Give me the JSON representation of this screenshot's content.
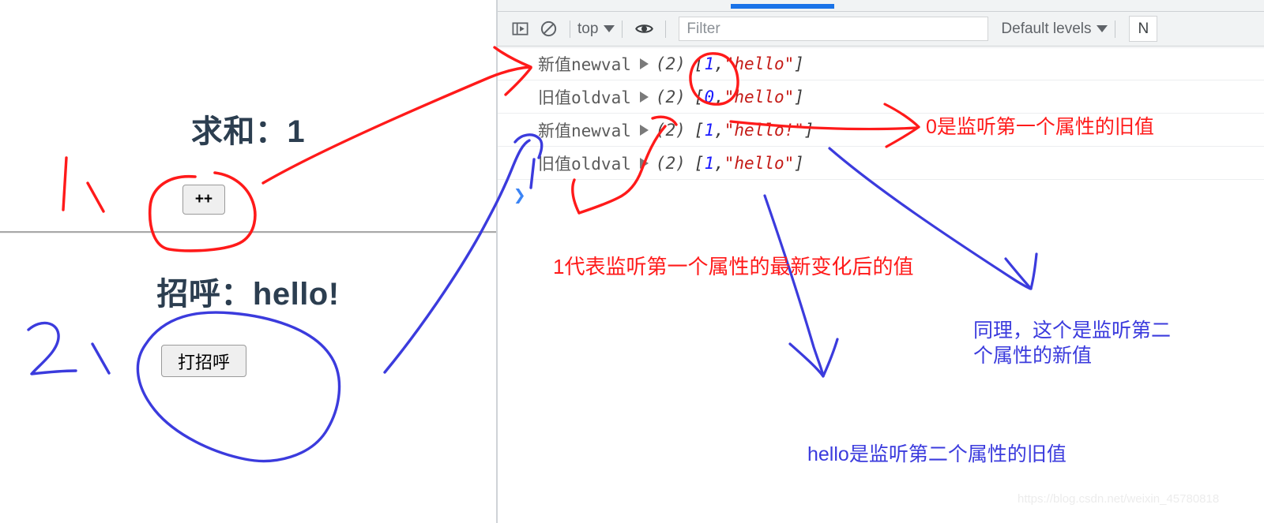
{
  "page": {
    "sum_heading": "求和：1",
    "greet_heading": "招呼：hello!",
    "increment_button": "++",
    "greet_button": "打招呼"
  },
  "devtools": {
    "toolbar": {
      "sidebar_icon": "console-sidebar-icon",
      "clear_icon": "clear-console-icon",
      "context_label": "top",
      "eye_icon": "live-expression-eye-icon",
      "filter_placeholder": "Filter",
      "filter_value": "",
      "levels_label": "Default levels",
      "issues_label": "N"
    },
    "console_rows": [
      {
        "label": "新值newval",
        "disclosure": "expand-triangle-icon",
        "count": "(2)",
        "open": "[",
        "num": "1",
        "comma": ", ",
        "str": "\"hello\"",
        "close": "]"
      },
      {
        "label": "旧值oldval",
        "disclosure": "expand-triangle-icon",
        "count": "(2)",
        "open": "[",
        "num": "0",
        "comma": ", ",
        "str": "\"hello\"",
        "close": "]"
      },
      {
        "label": "新值newval",
        "disclosure": "expand-triangle-icon",
        "count": "(2)",
        "open": "[",
        "num": "1",
        "comma": ", ",
        "str": "\"hello!\"",
        "close": "]"
      },
      {
        "label": "旧值oldval",
        "disclosure": "expand-triangle-icon",
        "count": "(2)",
        "open": "[",
        "num": "1",
        "comma": ", ",
        "str": "\"hello\"",
        "close": "]"
      }
    ],
    "prompt_caret": "❯"
  },
  "annotations": {
    "old_value_first": "0是监听第一个属性的旧值",
    "new_value_first": "1代表监听第一个属性的最新变化后的值",
    "second_new_line1": "同理，这个是监听第二",
    "second_new_line2": "个属性的新值",
    "second_old": "hello是监听第二个属性的旧值",
    "marker_one": "1、",
    "marker_two": "2、"
  },
  "watermark": "https://blog.csdn.net/weixin_45780818",
  "colors": {
    "ink_red": "#ff1a1a",
    "ink_blue": "#3b3bdd",
    "accent_blue": "#1a73e8",
    "heading": "#2c3e50",
    "string_token": "#c41a16",
    "number_token": "#1a1aff"
  }
}
